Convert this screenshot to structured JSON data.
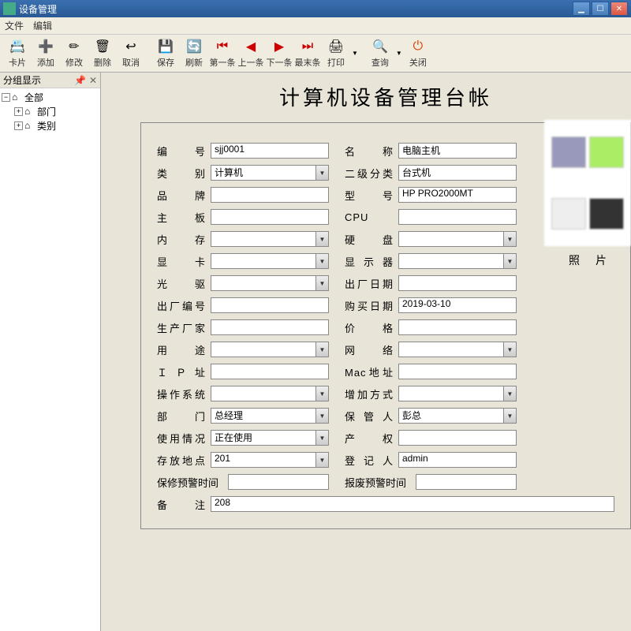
{
  "window": {
    "title": "设备管理"
  },
  "menu": {
    "file": "文件",
    "edit": "编辑"
  },
  "toolbar": {
    "card": "卡片",
    "add": "添加",
    "modify": "修改",
    "delete": "删除",
    "cancel": "取消",
    "save": "保存",
    "refresh": "刷新",
    "first": "第一条",
    "prev": "上一条",
    "next": "下一条",
    "last": "最末条",
    "print": "打印",
    "query": "查询",
    "close": "关闭"
  },
  "sidebar": {
    "header": "分组显示",
    "root": "全部",
    "node1": "部门",
    "node2": "类别"
  },
  "page": {
    "title": "计算机设备管理台帐",
    "photo_label": "照片"
  },
  "form": {
    "left": {
      "id": {
        "label": "编　号",
        "value": "sjj0001"
      },
      "category": {
        "label": "类　别",
        "value": "计算机"
      },
      "brand": {
        "label": "品　牌",
        "value": ""
      },
      "mainboard": {
        "label": "主　板",
        "value": ""
      },
      "memory": {
        "label": "内　存",
        "value": ""
      },
      "gpu": {
        "label": "显　卡",
        "value": ""
      },
      "cdrom": {
        "label": "光　驱",
        "value": ""
      },
      "serial": {
        "label": "出厂编号",
        "value": ""
      },
      "manufacturer": {
        "label": "生产厂家",
        "value": ""
      },
      "usage": {
        "label": "用　途",
        "value": ""
      },
      "ip": {
        "label": "ＩＰ址",
        "value": ""
      },
      "os": {
        "label": "操作系统",
        "value": ""
      },
      "dept": {
        "label": "部　门",
        "value": "总经理"
      },
      "status": {
        "label": "使用情况",
        "value": "正在使用"
      },
      "location": {
        "label": "存放地点",
        "value": "201"
      },
      "warranty": {
        "label": "保修预警时间",
        "value": ""
      }
    },
    "right": {
      "name": {
        "label": "名　称",
        "value": "电脑主机"
      },
      "subcat": {
        "label": "二级分类",
        "value": "台式机"
      },
      "model": {
        "label": "型　号",
        "value": "HP PRO2000MT"
      },
      "cpu": {
        "label": "CPU",
        "value": ""
      },
      "hdd": {
        "label": "硬　盘",
        "value": ""
      },
      "monitor": {
        "label": "显示器",
        "value": ""
      },
      "mfgdate": {
        "label": "出厂日期",
        "value": ""
      },
      "buydate": {
        "label": "购买日期",
        "value": "2019-03-10"
      },
      "price": {
        "label": "价　格",
        "value": ""
      },
      "network": {
        "label": "网　络",
        "value": ""
      },
      "mac": {
        "label": "Mac地址",
        "value": ""
      },
      "addmethod": {
        "label": "增加方式",
        "value": ""
      },
      "keeper": {
        "label": "保管人",
        "value": "彭总"
      },
      "ownership": {
        "label": "产　权",
        "value": ""
      },
      "registrar": {
        "label": "登记人",
        "value": "admin"
      },
      "scrap": {
        "label": "报废预警时间",
        "value": ""
      }
    },
    "remark": {
      "label": "备　注",
      "value": "208"
    }
  }
}
